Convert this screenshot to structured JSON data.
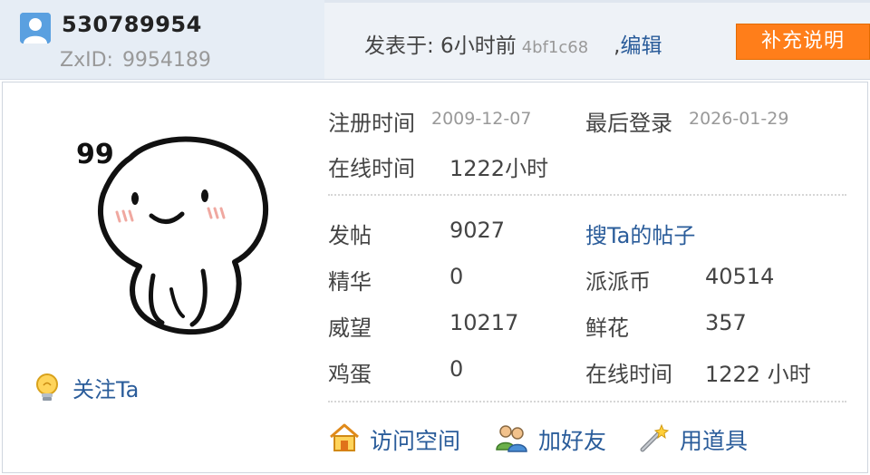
{
  "header": {
    "username": "530789954",
    "zxid_label": "ZxID:",
    "zxid_value": "9954189",
    "posted_prefix": "发表于: 6小时前",
    "post_hash": "4bf1c68",
    "comma": ",",
    "edit_label": "编辑",
    "supplement_label": "补充说明"
  },
  "avatar": {
    "badge_text": "99"
  },
  "follow_label": "关注Ta",
  "profile": {
    "register_label": "注册时间",
    "register_value": "2009-12-07",
    "last_login_label": "最后登录",
    "last_login_value": "2026-01-29",
    "online_label": "在线时间",
    "online_value": "1222小时"
  },
  "stats": {
    "posts_label": "发帖",
    "posts_value": "9027",
    "search_posts_label": "搜Ta的帖子",
    "essence_label": "精华",
    "essence_value": "0",
    "coin_label": "派派币",
    "coin_value": "40514",
    "prestige_label": "威望",
    "prestige_value": "10217",
    "flowers_label": "鲜花",
    "flowers_value": "357",
    "eggs_label": "鸡蛋",
    "eggs_value": "0",
    "online_label": "在线时间",
    "online_value": "1222 小时"
  },
  "actions": {
    "visit_space": "访问空间",
    "add_friend": "加好友",
    "use_item": "用道具"
  },
  "colors": {
    "link": "#2a5c9a",
    "accent_orange": "#ff7e1a",
    "header_bg": "#e6edf5"
  },
  "icons": [
    "user-icon",
    "bulb-icon",
    "house-icon",
    "friends-icon",
    "wand-icon"
  ]
}
